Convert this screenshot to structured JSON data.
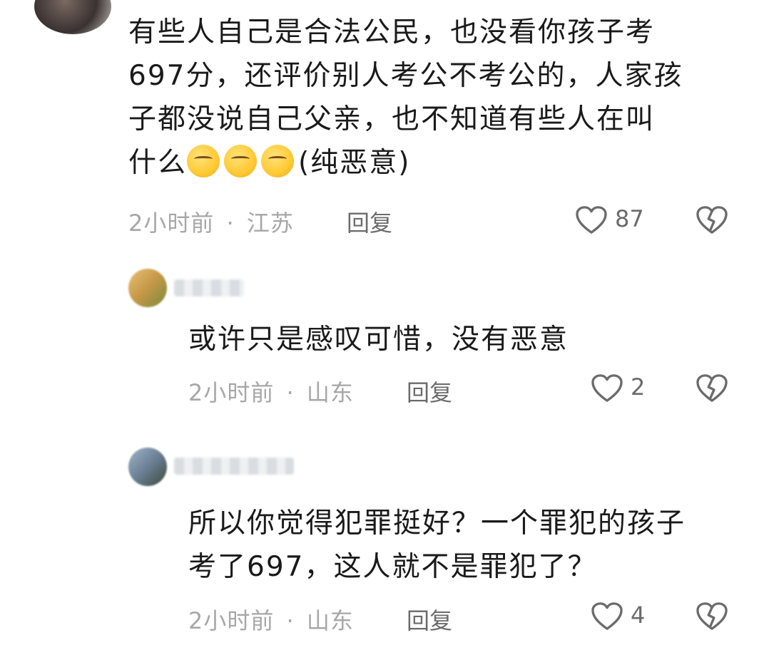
{
  "comment": {
    "text_lines": [
      "有些人自己是合法公民，也没看你孩子考",
      "697分，还评价别人考公不考公的，人家孩",
      "子都没说自己父亲，也不知道有些人在叫",
      "什么"
    ],
    "text_suffix": "(纯恶意)",
    "emoji_icon": "face-with-steam-emoji",
    "time": "2小时前",
    "location": "江苏",
    "reply_label": "回复",
    "likes": "87"
  },
  "replies": [
    {
      "text_lines": [
        "或许只是感叹可惜，没有恶意"
      ],
      "time": "2小时前",
      "location": "山东",
      "reply_label": "回复",
      "likes": "2"
    },
    {
      "text_lines": [
        "所以你觉得犯罪挺好？一个罪犯的孩子",
        "考了697，这人就不是罪犯了？"
      ],
      "time": "2小时前",
      "location": "山东",
      "reply_label": "回复",
      "likes": "4"
    }
  ],
  "separator": "·",
  "colors": {
    "meta": "#a7a7a7",
    "text": "#1a1a1a",
    "icon": "#6b6b6b"
  }
}
